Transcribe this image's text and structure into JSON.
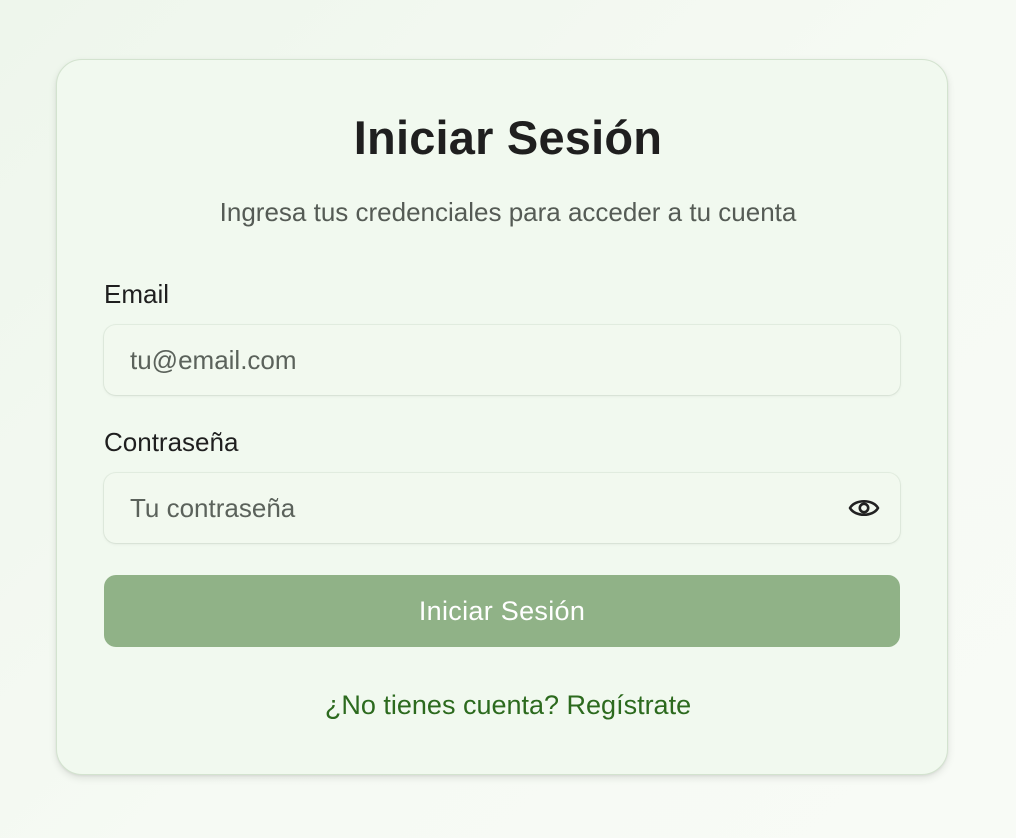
{
  "login": {
    "title": "Iniciar Sesión",
    "subtitle": "Ingresa tus credenciales para acceder a tu cuenta",
    "email": {
      "label": "Email",
      "placeholder": "tu@email.com",
      "value": ""
    },
    "password": {
      "label": "Contraseña",
      "placeholder": "Tu contraseña",
      "value": "",
      "toggle_icon": "eye-icon"
    },
    "submit_label": "Iniciar Sesión",
    "register_link": "¿No tienes cuenta? Regístrate"
  },
  "colors": {
    "accent": "#90b287",
    "link": "#2c6a1e",
    "card_background": "#f1f9ef",
    "text": "#1f1f1f"
  }
}
